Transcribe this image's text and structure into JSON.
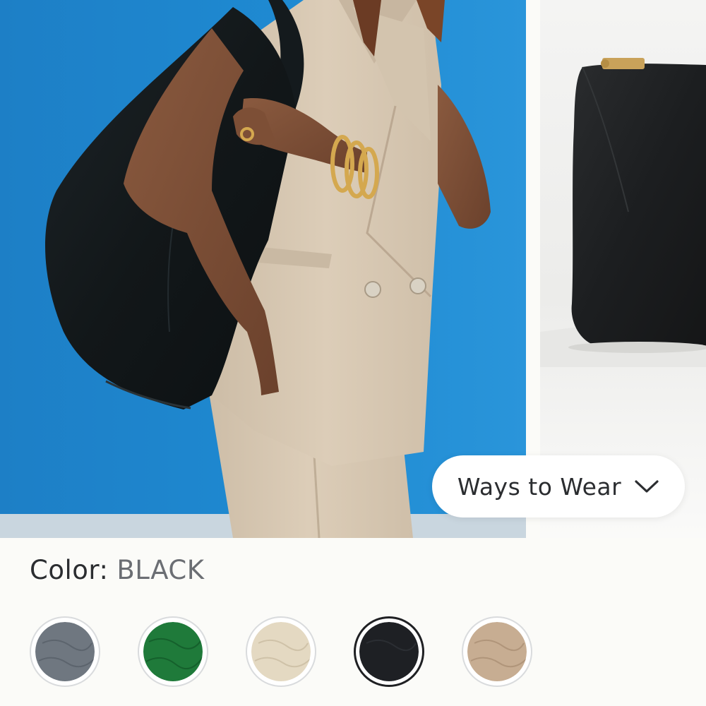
{
  "gallery": {
    "main_image_alt": "Model wearing black leather shoulder bag with beige suit",
    "next_image_alt": "Black leather pouch",
    "ways_to_wear_label": "Ways to Wear"
  },
  "color": {
    "label": "Color:",
    "selected": "BLACK",
    "swatches": [
      {
        "name": "slate-grey",
        "hex": "#6f7780",
        "selected": false
      },
      {
        "name": "green",
        "hex": "#1f7a3a",
        "selected": false
      },
      {
        "name": "cream",
        "hex": "#e4d9c2",
        "selected": false
      },
      {
        "name": "black",
        "hex": "#1e2024",
        "selected": true
      },
      {
        "name": "taupe",
        "hex": "#c7ad92",
        "selected": false
      }
    ]
  },
  "colors": {
    "backdrop_blue": "#1f86cf",
    "suit_beige": "#d8c9b4"
  }
}
